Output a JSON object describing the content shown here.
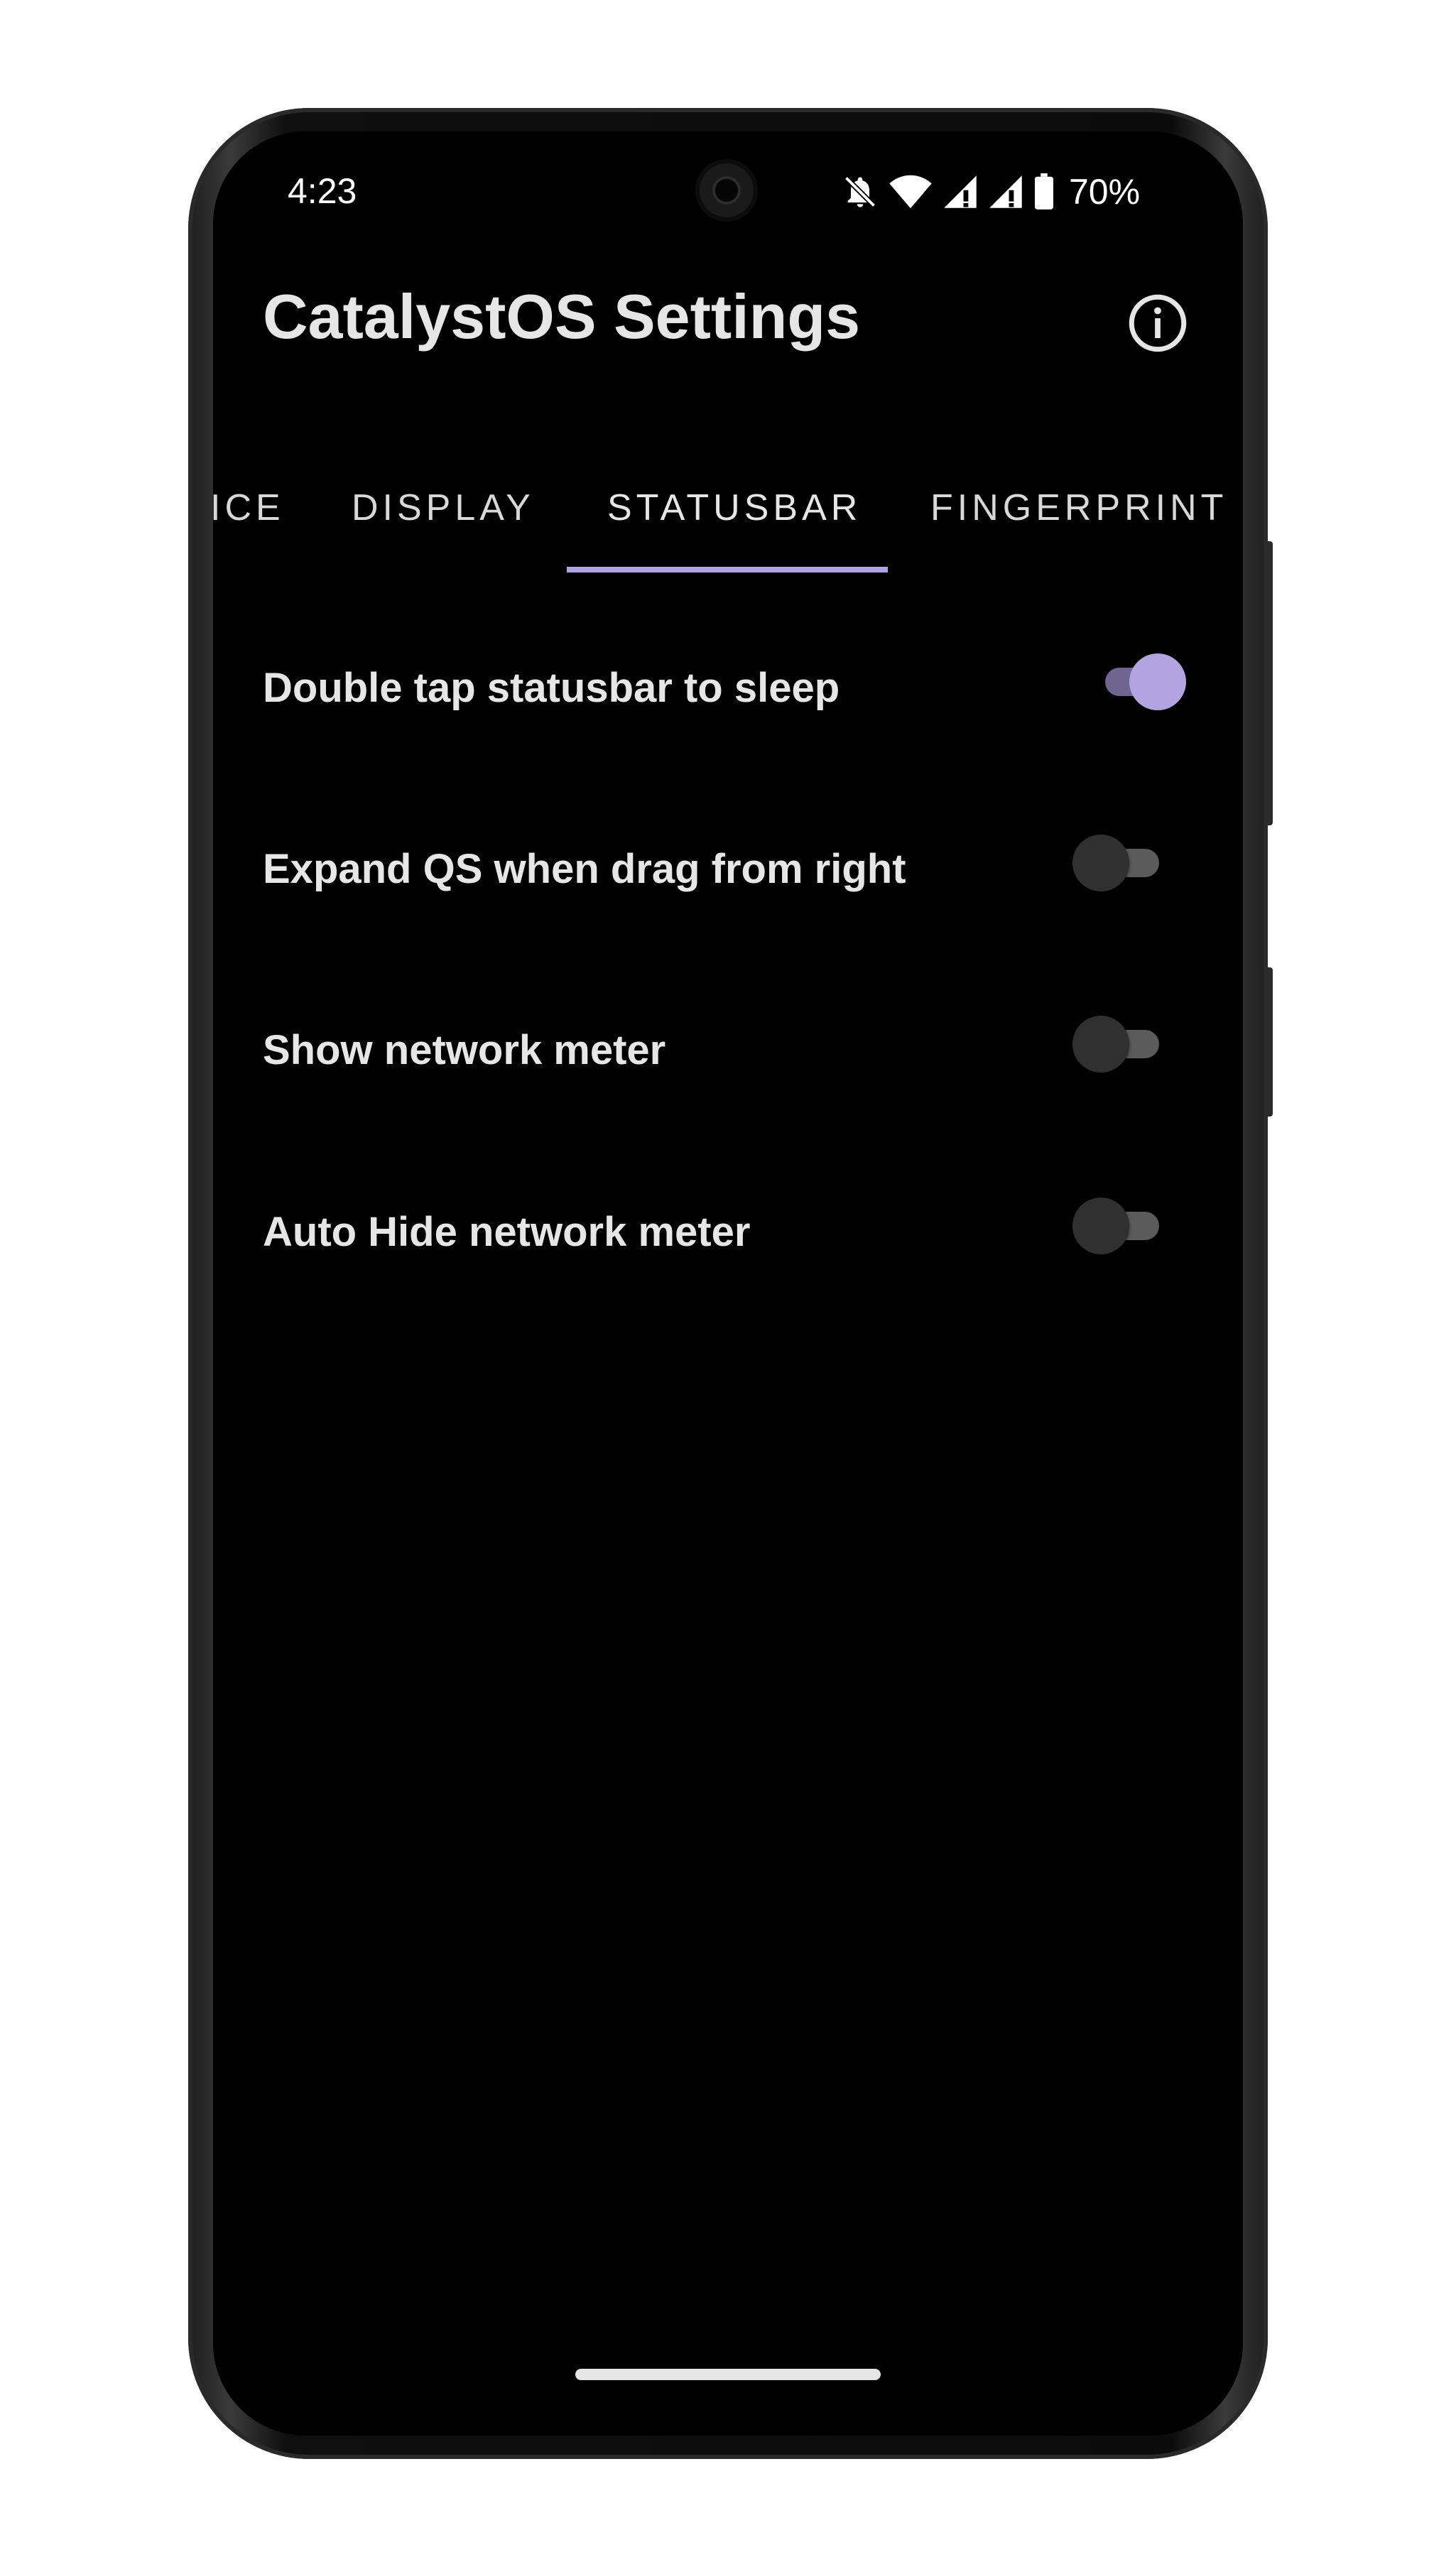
{
  "status_bar": {
    "time": "4:23",
    "battery_percent": "70%",
    "icons": [
      "bell-off-icon",
      "wifi-icon",
      "cellular-signal-icon",
      "cellular-signal-icon",
      "battery-icon"
    ]
  },
  "app_bar": {
    "title": "CatalystOS Settings",
    "info_icon": "info-icon"
  },
  "tabs": [
    {
      "label": "ICE",
      "selected": false
    },
    {
      "label": "DISPLAY",
      "selected": false
    },
    {
      "label": "STATUSBAR",
      "selected": true
    },
    {
      "label": "FINGERPRINT",
      "selected": false
    }
  ],
  "settings": [
    {
      "label": "Double tap statusbar to sleep",
      "enabled": true
    },
    {
      "label": "Expand QS when drag from right",
      "enabled": false
    },
    {
      "label": "Show network meter",
      "enabled": false
    },
    {
      "label": "Auto Hide network meter",
      "enabled": false
    }
  ],
  "colors": {
    "accent": "#b3a4e0",
    "background": "#000000",
    "text": "#e6e6e6"
  }
}
